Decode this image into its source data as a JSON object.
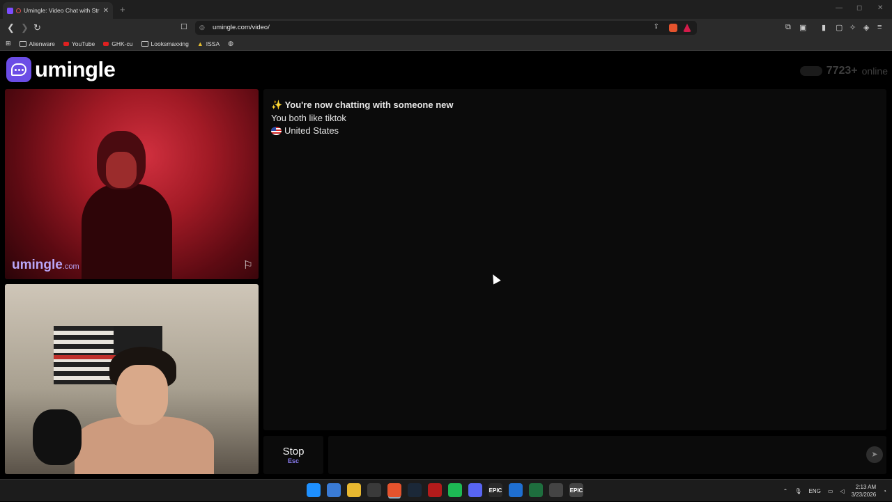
{
  "browser": {
    "tab": {
      "title": "Umingle: Video Chat with Str",
      "close": "✕"
    },
    "new_tab": "+",
    "window_controls": {
      "minimize": "—",
      "maximize": "◻",
      "close": "✕"
    },
    "url": "umingle.com/video/",
    "bookmarks": [
      {
        "label": "Alienware",
        "icon": "folder-icon"
      },
      {
        "label": "YouTube",
        "icon": "youtube-icon"
      },
      {
        "label": "GHK-cu",
        "icon": "youtube-icon"
      },
      {
        "label": "Looksmaxxing",
        "icon": "folder-icon"
      },
      {
        "label": "ISSA",
        "icon": "isa-icon"
      }
    ]
  },
  "site": {
    "logo_text": "umingle",
    "online_count": "7723+",
    "online_label": "online"
  },
  "video": {
    "watermark_main": "umingle",
    "watermark_tld": ".com"
  },
  "chat": {
    "line1_emoji": "✨",
    "line1": "You're now chatting with someone new",
    "line2": "You both like tiktok",
    "line3": "United States"
  },
  "controls": {
    "stop_label": "Stop",
    "stop_key": "Esc",
    "message_placeholder": ""
  },
  "taskbar": {
    "lang": "ENG",
    "time": "2:13 AM",
    "date": "3/23/2026",
    "apps": [
      {
        "name": "windows-start-icon",
        "color": "#1e90ff",
        "label": ""
      },
      {
        "name": "copilot-icon",
        "color": "#3a7bd5",
        "label": ""
      },
      {
        "name": "file-explorer-icon",
        "color": "#e8b830",
        "label": ""
      },
      {
        "name": "store-icon",
        "color": "#3a3a3a",
        "label": ""
      },
      {
        "name": "brave-icon",
        "color": "#e5532d",
        "label": ""
      },
      {
        "name": "steam-icon",
        "color": "#1b2838",
        "label": ""
      },
      {
        "name": "app-red-icon",
        "color": "#b31b1b",
        "label": ""
      },
      {
        "name": "spotify-icon",
        "color": "#1db954",
        "label": ""
      },
      {
        "name": "discord-icon",
        "color": "#5865f2",
        "label": ""
      },
      {
        "name": "epic-games-icon",
        "color": "#2a2a2a",
        "label": "EPIC"
      },
      {
        "name": "app-blue-icon",
        "color": "#1f6fd1",
        "label": ""
      },
      {
        "name": "excel-icon",
        "color": "#1e6e3e",
        "label": ""
      },
      {
        "name": "chrome-icon",
        "color": "#444",
        "label": ""
      },
      {
        "name": "epic-launcher-icon",
        "color": "#444",
        "label": "EPIC"
      }
    ]
  }
}
